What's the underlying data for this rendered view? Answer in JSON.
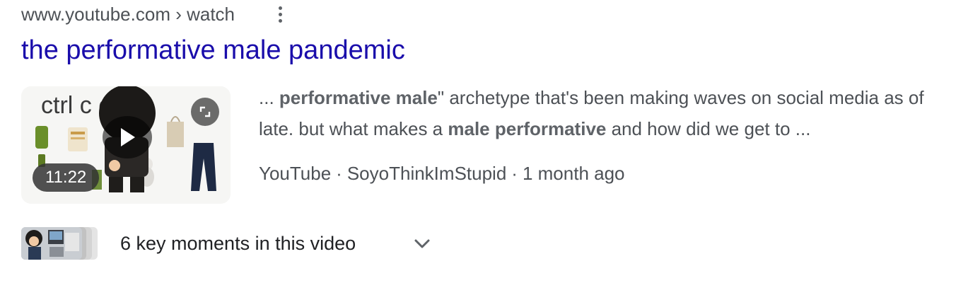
{
  "result": {
    "breadcrumb": "www.youtube.com › watch",
    "title": "the performative male pandemic",
    "snippet": {
      "parts": [
        {
          "text": "... ",
          "bold": false
        },
        {
          "text": "performative male",
          "bold": true
        },
        {
          "text": "\" archetype that's been making waves on social media as of late. but what makes a ",
          "bold": false
        },
        {
          "text": "male performative",
          "bold": true
        },
        {
          "text": " and how did we get to ...",
          "bold": false
        }
      ]
    },
    "source": {
      "site": "YouTube",
      "channel": "SoyoThinkImStupid",
      "age": "1 month ago",
      "separator": "·"
    },
    "video": {
      "duration": "11:22",
      "thumbnail_text": "ctrl c ctrl v"
    },
    "key_moments": {
      "label": "6 key moments in this video"
    }
  },
  "icons": {
    "more": "more-vert-icon",
    "play": "play-icon",
    "expand": "expand-icon",
    "chevron": "chevron-down-icon"
  },
  "colors": {
    "link": "#1a0dab",
    "text": "#4d5156",
    "bold": "#5f6368"
  }
}
